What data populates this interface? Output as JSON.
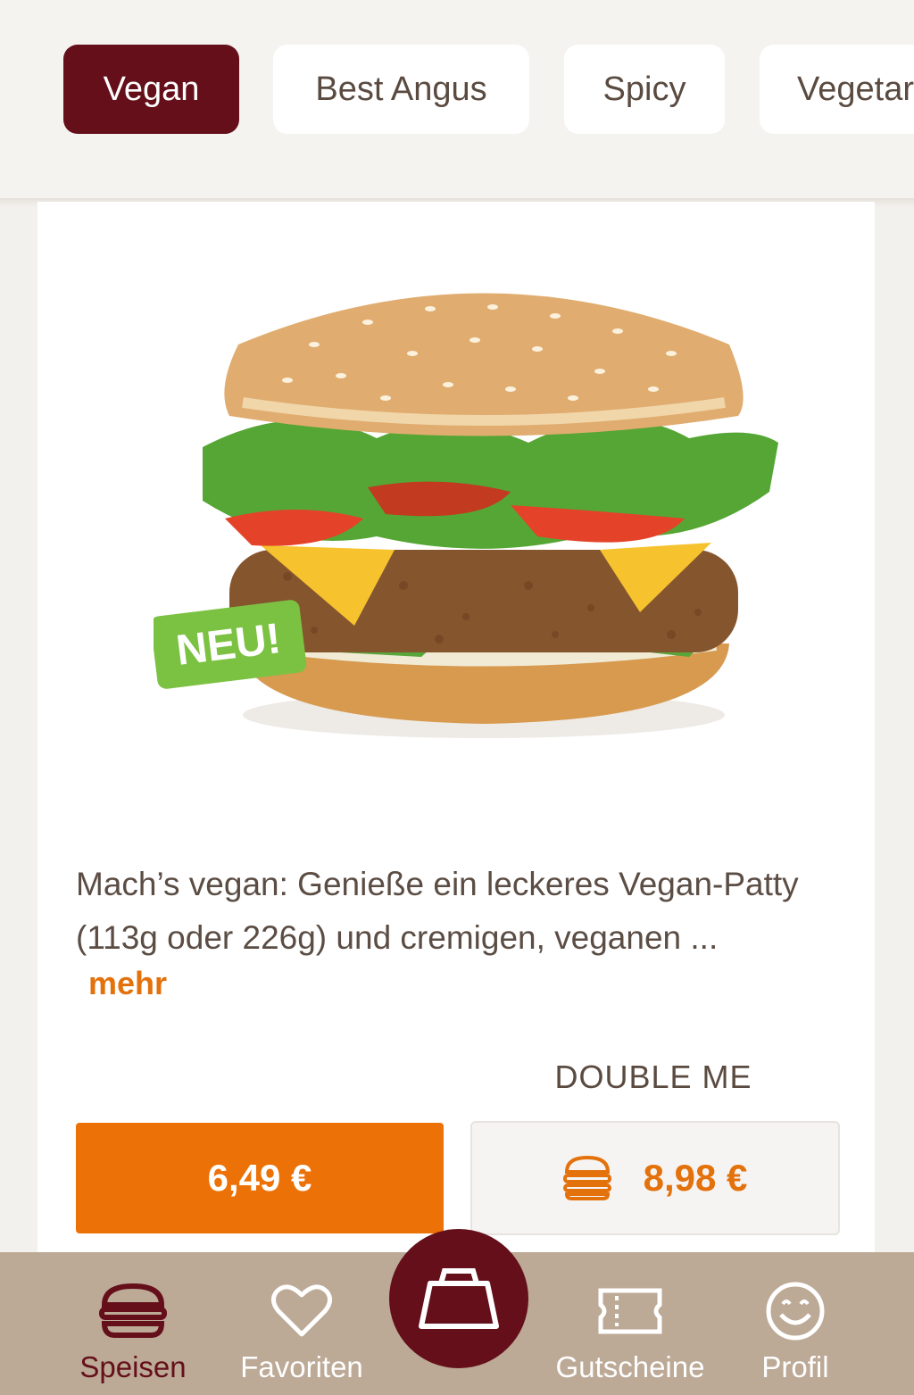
{
  "categories": [
    {
      "label": "Vegan",
      "active": true
    },
    {
      "label": "Best Angus",
      "active": false
    },
    {
      "label": "Spicy",
      "active": false
    },
    {
      "label": "Vegetar",
      "active": false
    }
  ],
  "product": {
    "badge": "NEU!",
    "description": "Mach’s vegan: Genieße ein leckeres Vegan-Patty (113g oder 226g) und cremigen, veganen  ...",
    "more_label": "mehr",
    "price": "6,49 €",
    "double_label": "DOUBLE ME",
    "double_price": "8,98 €"
  },
  "nav": {
    "items": [
      {
        "label": "Speisen",
        "icon": "burger-icon",
        "active": true
      },
      {
        "label": "Favoriten",
        "icon": "heart-icon",
        "active": false
      },
      {
        "label": "Gutscheine",
        "icon": "ticket-icon",
        "active": false
      },
      {
        "label": "Profil",
        "icon": "smiley-icon",
        "active": false
      }
    ],
    "cart_icon": "shopping-bag-icon"
  },
  "colors": {
    "brand_dark_red": "#640f19",
    "accent_orange": "#ec7106",
    "nav_background": "#bca996"
  }
}
